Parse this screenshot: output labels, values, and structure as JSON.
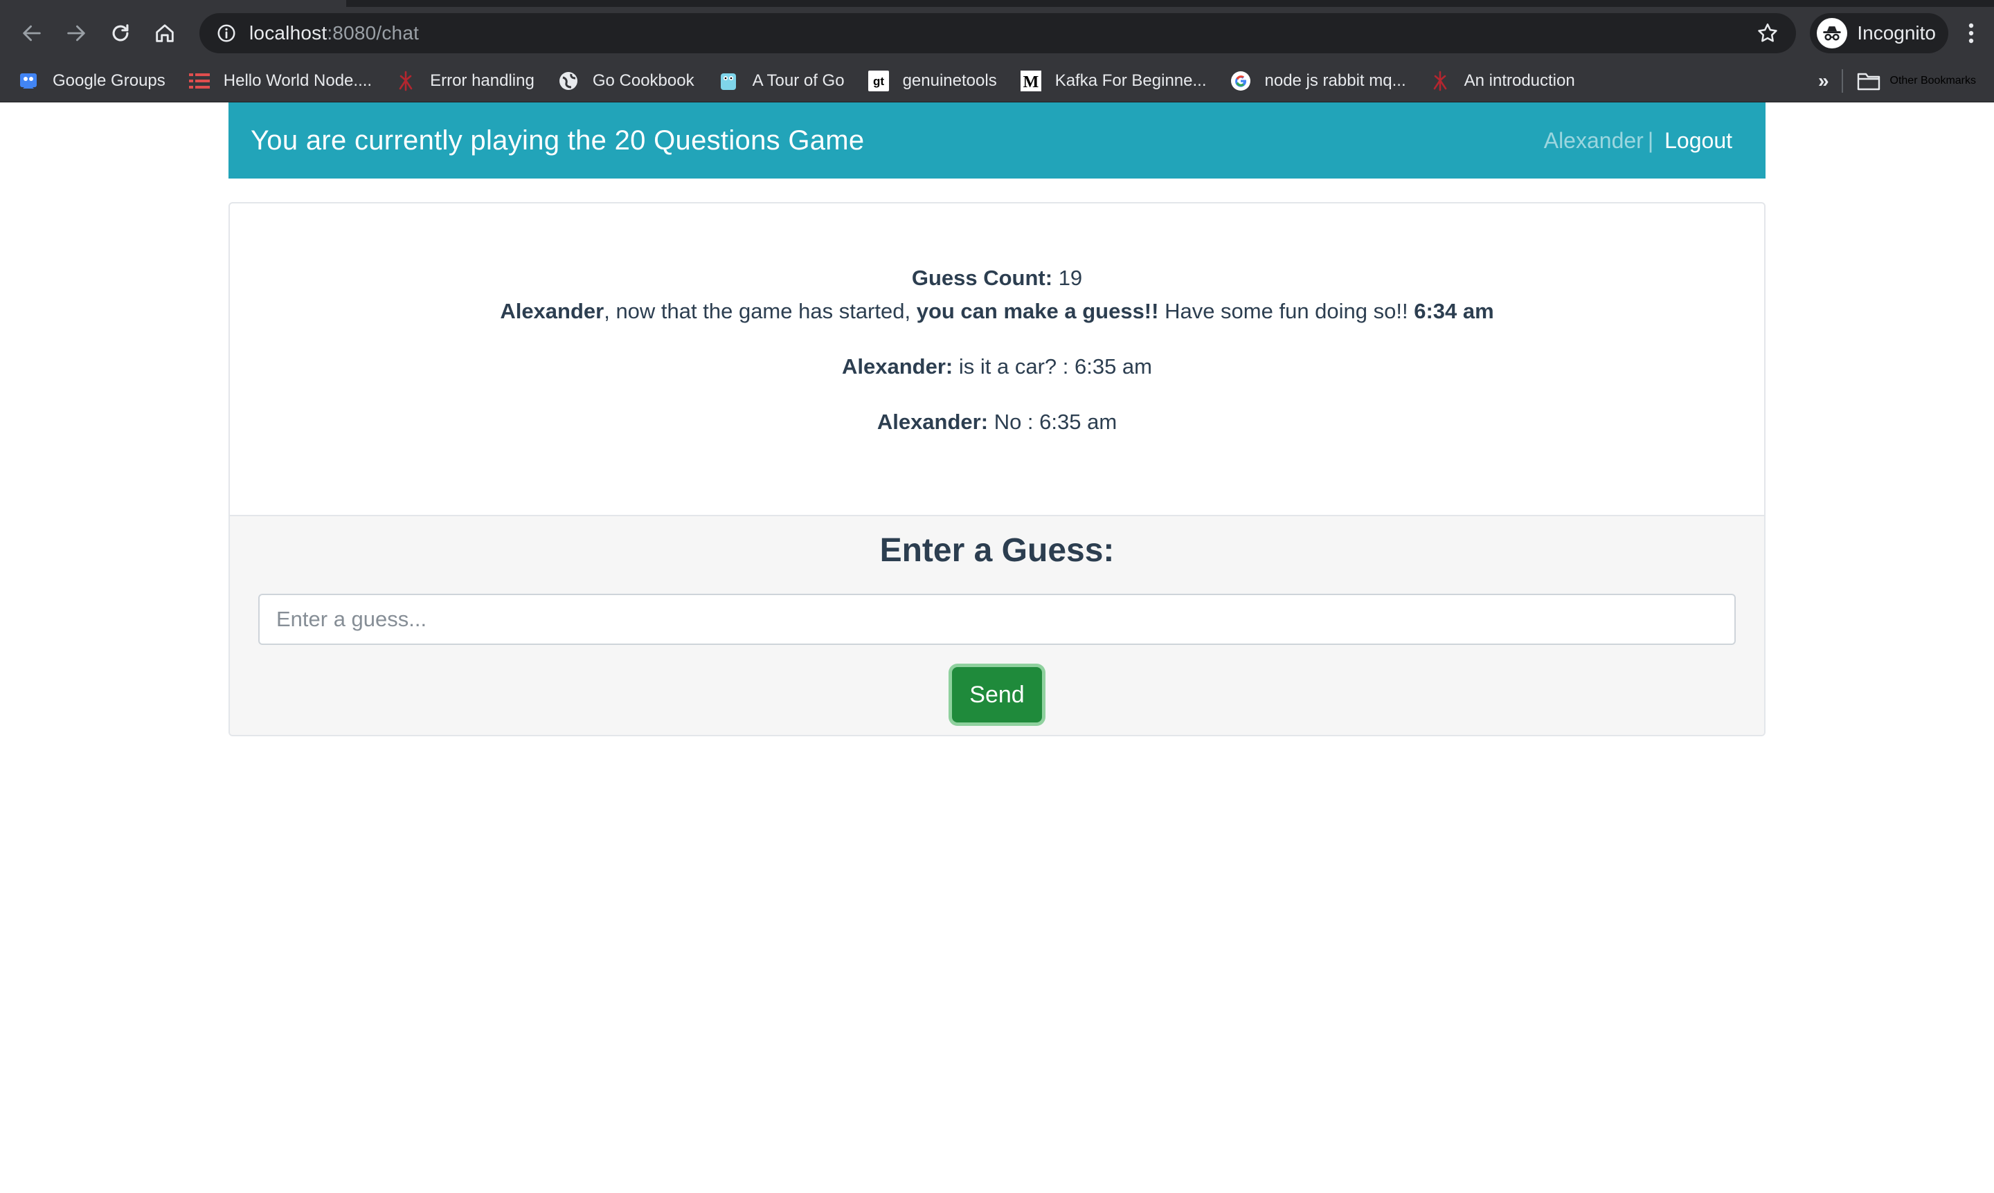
{
  "browser": {
    "url_host": "localhost",
    "url_path": ":8080/chat",
    "profile_label": "Incognito",
    "bookmarks": [
      {
        "label": "Google Groups",
        "icon": "google-groups-icon"
      },
      {
        "label": "Hello World Node....",
        "icon": "hello-world-node-icon"
      },
      {
        "label": "Error handling",
        "icon": "error-handling-icon"
      },
      {
        "label": "Go Cookbook",
        "icon": "go-cookbook-icon"
      },
      {
        "label": "A Tour of Go",
        "icon": "tour-of-go-icon"
      },
      {
        "label": "genuinetools",
        "icon": "genuinetools-icon"
      },
      {
        "label": "Kafka For Beginne...",
        "icon": "medium-icon"
      },
      {
        "label": "node js rabbit mq...",
        "icon": "google-icon"
      },
      {
        "label": "An introduction",
        "icon": "introduction-icon"
      }
    ],
    "overflow_label": "»",
    "other_bookmarks_label": "Other Bookmarks"
  },
  "header": {
    "title": "You are currently playing the 20 Questions Game",
    "username": "Alexander",
    "separator": "|",
    "logout_label": "Logout"
  },
  "game": {
    "guess_count_label": "Guess Count:",
    "guess_count_value": "19",
    "intro": {
      "name": "Alexander",
      "text_1": ", now that the game has started, ",
      "emphasis": "you can make a guess!!",
      "text_2": " Have some fun doing so!! ",
      "time": "6:34 am"
    },
    "messages": [
      {
        "sender": "Alexander:",
        "text": "is it a car? : 6:35 am"
      },
      {
        "sender": "Alexander:",
        "text": "No : 6:35 am"
      }
    ]
  },
  "form": {
    "title": "Enter a Guess:",
    "placeholder": "Enter a guess...",
    "value": "",
    "send_label": "Send"
  },
  "colors": {
    "header_bg": "#22a4b9",
    "send_button": "#1f8a3b",
    "text": "#2c3e50"
  }
}
